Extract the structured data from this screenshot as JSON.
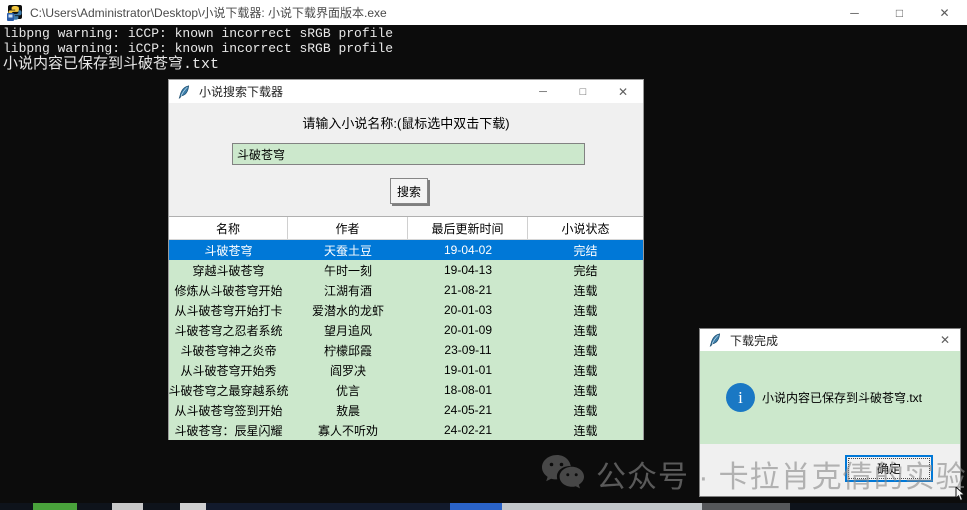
{
  "console": {
    "icon": "python-console-icon",
    "title": "C:\\Users\\Administrator\\Desktop\\小说下载器: 小说下载界面版本.exe",
    "window_controls": {
      "minimize": "─",
      "maximize": "□",
      "close": "✕"
    },
    "output_lines": [
      "libpng warning: iCCP: known incorrect sRGB profile",
      "libpng warning: iCCP: known incorrect sRGB profile",
      "小说内容已保存到斗破苍穹.txt"
    ]
  },
  "main_window": {
    "icon": "tk-feather-icon",
    "title": "小说搜索下载器",
    "window_controls": {
      "minimize": "─",
      "maximize": "□",
      "close": "✕"
    },
    "prompt_label": "请输入小说名称:(鼠标选中双击下载)",
    "search_input": {
      "value": "斗破苍穹"
    },
    "search_button_label": "搜索",
    "table": {
      "columns": [
        "名称",
        "作者",
        "最后更新时间",
        "小说状态"
      ],
      "selected_row": 0,
      "rows": [
        [
          "斗破苍穹",
          "天蚕土豆",
          "19-04-02",
          "完结"
        ],
        [
          "穿越斗破苍穹",
          "午时一刻",
          "19-04-13",
          "完结"
        ],
        [
          "修炼从斗破苍穹开始",
          "江湖有酒",
          "21-08-21",
          "连载"
        ],
        [
          "从斗破苍穹开始打卡",
          "爱潜水的龙虾",
          "20-01-03",
          "连载"
        ],
        [
          "斗破苍穹之忍者系统",
          "望月追风",
          "20-01-09",
          "连载"
        ],
        [
          "斗破苍穹神之炎帝",
          "柠檬邱霞",
          "23-09-11",
          "连载"
        ],
        [
          "从斗破苍穹开始秀",
          "阎罗决",
          "19-01-01",
          "连载"
        ],
        [
          "斗破苍穹之最穿越系统",
          "优言",
          "18-08-01",
          "连载"
        ],
        [
          "从斗破苍穹签到开始",
          "敖晨",
          "24-05-21",
          "连载"
        ],
        [
          "斗破苍穹：辰星闪耀",
          "寡人不听劝",
          "24-02-21",
          "连载"
        ]
      ]
    }
  },
  "dialog": {
    "icon": "tk-feather-icon",
    "title": "下载完成",
    "close_glyph": "✕",
    "info_glyph": "i",
    "message": "小说内容已保存到斗破苍穹.txt",
    "ok_button_label": "确定"
  },
  "watermark": {
    "icon": "wechat-icon",
    "text": "公众号 · 卡拉肖克倩的实验室"
  },
  "colors": {
    "selection_blue": "#0078d7",
    "soft_green": "#cce8cc",
    "console_black": "#0c0c0c",
    "window_gray": "#f0f0f0",
    "titlebar_white": "#ffffff",
    "info_blue": "#1a78c4",
    "focus_border_blue": "#0078d7"
  }
}
